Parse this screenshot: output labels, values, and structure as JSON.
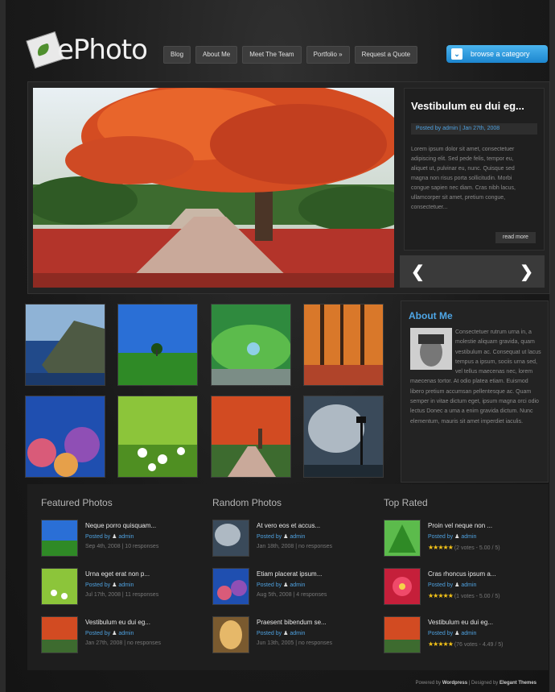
{
  "logo": {
    "text": "ePhoto"
  },
  "nav": {
    "items": [
      "Blog",
      "About Me",
      "Meet The Team",
      "Portfolio »",
      "Request a Quote"
    ]
  },
  "browse": {
    "label": "browse a category"
  },
  "featured": {
    "title": "Vestibulum eu dui eg...",
    "meta": "Posted by admin | Jan 27th, 2008",
    "body": "Lorem ipsum dolor sit amet, consectetuer adipiscing elit. Sed pede felis, tempor eu, aliquet ut, pulvinar eu, nunc. Quisque sed magna non risus porta sollicitudin. Morbi congue sapien nec diam. Cras nibh lacus, ullamcorper sit amet, pretium congue, consectetuer...",
    "read_more": "read more"
  },
  "about": {
    "title": "About Me",
    "body": "Consectetuer rutrum urna in, a molestie aliquam gravida, quam vestibulum ac. Consequat ut lacus tempus a ipsum, sociis urna sed, vel tellus maecenas nec, lorem maecenas tortor. At odio platea etiam. Euismod libero pretium accumsan pellentesque ac. Quam semper in vitae dictum eget, ipsum magna orci odio lectus Donec a uma a enim gravida dictum. Nunc elementum, mauris sit amet imperdiet iaculis."
  },
  "columns": [
    {
      "title": "Featured Photos",
      "items": [
        {
          "title": "Neque porro quisquam...",
          "meta": "Posted by",
          "author": "admin",
          "date": "Sep 4th, 2008 | 10 responses"
        },
        {
          "title": "Urna eget erat non p...",
          "meta": "Posted by",
          "author": "admin",
          "date": "Jul 17th, 2008 | 11 responses"
        },
        {
          "title": "Vestibulum eu dui eg...",
          "meta": "Posted by",
          "author": "admin",
          "date": "Jan 27th, 2008 | no responses"
        }
      ]
    },
    {
      "title": "Random Photos",
      "items": [
        {
          "title": "At vero eos et accus...",
          "meta": "Posted by",
          "author": "admin",
          "date": "Jan 18th, 2008 | no responses"
        },
        {
          "title": "Etiam placerat ipsum...",
          "meta": "Posted by",
          "author": "admin",
          "date": "Aug 5th, 2008 | 4 responses"
        },
        {
          "title": "Praesent bibendum se...",
          "meta": "Posted by",
          "author": "admin",
          "date": "Jun 13th, 2005 | no responses"
        }
      ]
    },
    {
      "title": "Top Rated",
      "items": [
        {
          "title": "Proin vel neque non ...",
          "meta": "Posted by",
          "author": "admin",
          "rating": "(2 votes - 5.00 / 5)"
        },
        {
          "title": "Cras rhoncus ipsum a...",
          "meta": "Posted by",
          "author": "admin",
          "rating": "(1 votes - 5.00 / 5)"
        },
        {
          "title": "Vestibulum eu dui eg...",
          "meta": "Posted by",
          "author": "admin",
          "rating": "(76 votes - 4.49 / 5)"
        }
      ]
    }
  ],
  "footer": {
    "powered": "Powered by",
    "wordpress": "Wordpress",
    "designed": " | Designed by",
    "elegant": "Elegant Themes"
  }
}
